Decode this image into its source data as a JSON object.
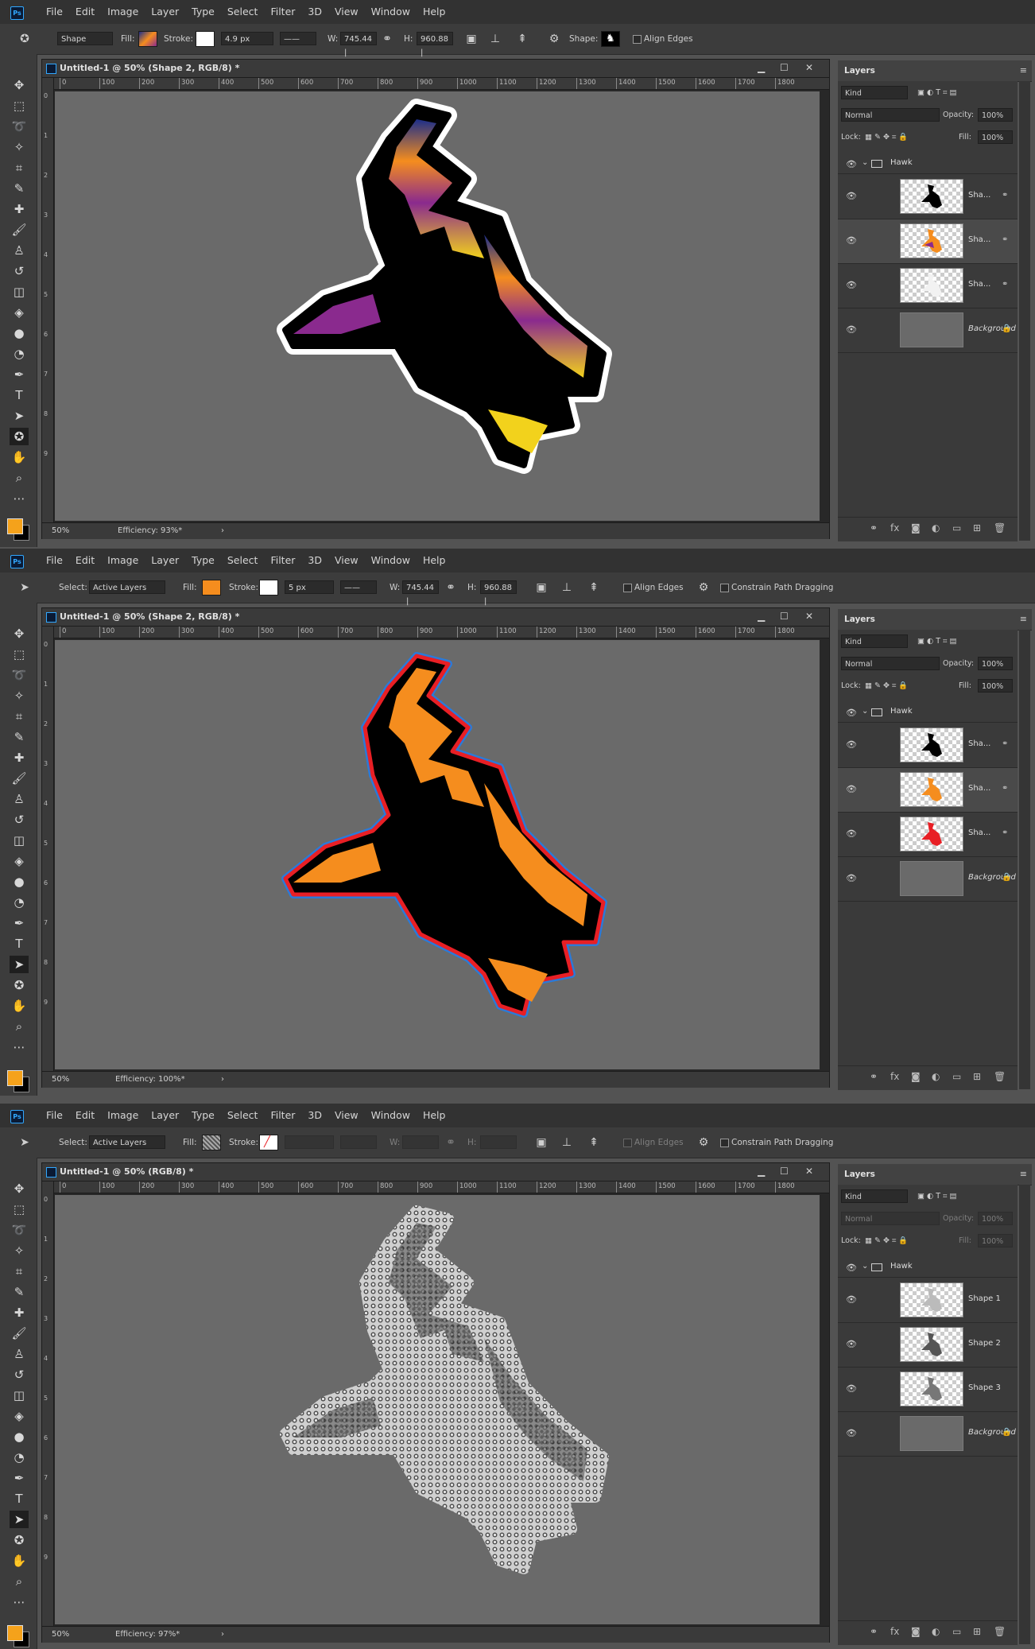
{
  "menu": [
    "File",
    "Edit",
    "Image",
    "Layer",
    "Type",
    "Select",
    "Filter",
    "3D",
    "View",
    "Window",
    "Help"
  ],
  "app_logo": "Ps",
  "screens": [
    {
      "options": {
        "tool_mode": "Shape",
        "fill_label": "Fill:",
        "stroke_label": "Stroke:",
        "stroke_width": "4.9 px",
        "w_label": "W:",
        "w_value": "745.44 |",
        "h_label": "H:",
        "h_value": "960.88 |",
        "shape_label": "Shape:",
        "align_edges": "Align Edges"
      },
      "doc_title": "Untitled-1 @ 50% (Shape 2, RGB/8) *",
      "zoom": "50%",
      "efficiency": "Efficiency: 93%*",
      "panel_title": "Layers",
      "kind": "Kind",
      "blend": "Normal",
      "opacity_label": "Opacity:",
      "opacity": "100%",
      "lock_label": "Lock:",
      "fill_label": "Fill:",
      "fill": "100%",
      "group_name": "Hawk",
      "layers": [
        "Sha...",
        "Sha...",
        "Sha...",
        "Background"
      ]
    },
    {
      "options": {
        "select_label": "Select:",
        "select_value": "Active Layers",
        "fill_label": "Fill:",
        "stroke_label": "Stroke:",
        "stroke_width": "5 px",
        "w_label": "W:",
        "w_value": "745.44 |",
        "h_label": "H:",
        "h_value": "960.88 |",
        "align_edges": "Align Edges",
        "constrain": "Constrain Path Dragging"
      },
      "doc_title": "Untitled-1 @ 50% (Shape 2, RGB/8) *",
      "zoom": "50%",
      "efficiency": "Efficiency: 100%*",
      "panel_title": "Layers",
      "kind": "Kind",
      "blend": "Normal",
      "opacity_label": "Opacity:",
      "opacity": "100%",
      "lock_label": "Lock:",
      "fill_label": "Fill:",
      "fill": "100%",
      "group_name": "Hawk",
      "layers": [
        "Sha...",
        "Sha...",
        "Sha...",
        "Background"
      ]
    },
    {
      "options": {
        "select_label": "Select:",
        "select_value": "Active Layers",
        "fill_label": "Fill:",
        "stroke_label": "Stroke:",
        "w_label": "W:",
        "h_label": "H:",
        "align_edges": "Align Edges",
        "constrain": "Constrain Path Dragging"
      },
      "doc_title": "Untitled-1 @ 50% (RGB/8) *",
      "zoom": "50%",
      "efficiency": "Efficiency: 97%*",
      "panel_title": "Layers",
      "kind": "Kind",
      "blend": "Normal",
      "opacity_label": "Opacity:",
      "opacity": "100%",
      "lock_label": "Lock:",
      "fill_label": "Fill:",
      "fill": "100%",
      "group_name": "Hawk",
      "layers": [
        "Shape 1",
        "Shape 2",
        "Shape 3",
        "Background"
      ]
    }
  ],
  "ruler_h": [
    "0",
    "100",
    "200",
    "300",
    "400",
    "500",
    "600",
    "700",
    "800",
    "900",
    "1000",
    "1100",
    "1200",
    "1300",
    "1400",
    "1500",
    "1600",
    "1700",
    "1800"
  ],
  "ruler_v": [
    "0",
    "1",
    "2",
    "3",
    "4",
    "5",
    "6",
    "7",
    "8",
    "9"
  ],
  "colors": {
    "foreground": "#f5a21b",
    "background": "#000000",
    "hawk_orange": "#f58d1e",
    "hawk_purple": "#8a2a8e",
    "hawk_blue": "#1c2e8a",
    "hawk_yellow": "#f2d21c",
    "stroke_red": "#e81f25",
    "stroke_blue": "#2b7ad8"
  }
}
